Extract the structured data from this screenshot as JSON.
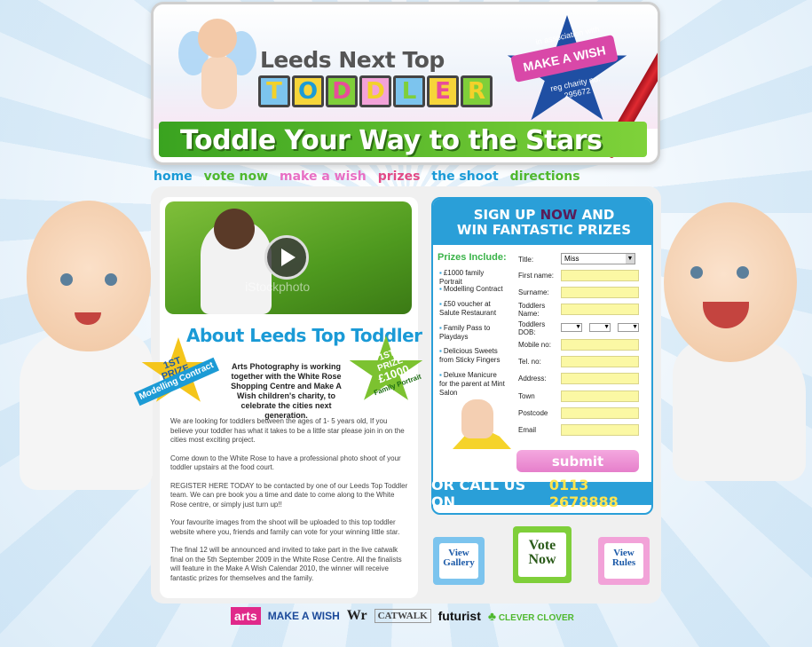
{
  "header": {
    "brand_top": "Leeds Next Top",
    "brand_letters": [
      "T",
      "O",
      "D",
      "D",
      "L",
      "E",
      "R"
    ],
    "badge_top": "in association with",
    "badge_ribbon": "MAKE A WISH",
    "badge_bottom_1": "reg charity no.",
    "badge_bottom_2": "295672",
    "tagline": "Toddle Your Way to the Stars"
  },
  "nav": {
    "items": [
      {
        "label": "home",
        "color": "#1a9ad6"
      },
      {
        "label": "vote now",
        "color": "#4fb82e"
      },
      {
        "label": "make a wish",
        "color": "#e86fc4"
      },
      {
        "label": "prizes",
        "color": "#e24a86"
      },
      {
        "label": "the shoot",
        "color": "#1a9ad6"
      },
      {
        "label": "directions",
        "color": "#4fb82e"
      }
    ]
  },
  "video": {
    "watermark": "iStockphoto"
  },
  "about": {
    "title": "About Leeds Top Toddler",
    "star1_line1": "1ST",
    "star1_line2": "PRIZE",
    "star1_ribbon": "Modelling Contract",
    "star2_line1": "1ST",
    "star2_line2": "PRIZE",
    "star2_line3": "£1000",
    "star2_line4": "Family Portrait",
    "intro": "Arts Photography is working together with the White Rose Shopping Centre and Make A Wish children's charity, to celebrate the cities next generation.",
    "paragraphs": [
      "We are looking for toddlers between the ages of 1- 5 years old, If you believe your toddler has what it takes to be a little star please join in on the cities most exciting project.",
      "Come down to the White Rose to have a professional photo shoot of your toddler upstairs at the food court.",
      "REGISTER HERE TODAY to be contacted by one of our Leeds Top Toddler team. We can pre book you a time and date to come along to the White Rose centre, or simply just turn up!!",
      "Your favourite images from the shoot will be uploaded to this top toddler website where you, friends and family can vote for your winning little star.",
      "The final 12 will be announced and invited to take part in the live catwalk final on the 5th September 2009 in the White Rose Centre. All the finalists will feature in the Make A Wish Calendar 2010, the winner will receive fantastic prizes for themselves and the family."
    ]
  },
  "signup": {
    "title_pre": "SIGN UP ",
    "title_now": "NOW",
    "title_post": " AND",
    "title_line2": "WIN FANTASTIC PRIZES",
    "prizes_head": "Prizes Include:",
    "prizes": [
      "£1000 family Portrait",
      "Modelling Contract",
      "£50 voucher at Salute Restaurant",
      "Family Pass to Playdays",
      "Delicious Sweets from Sticky Fingers",
      "Deluxe Manicure for the parent at Mint Salon"
    ],
    "labels": {
      "title": "Title:",
      "first_name": "First name:",
      "surname": "Surname:",
      "toddlers_name": "Toddlers Name:",
      "toddlers_dob": "Toddlers DOB:",
      "mobile": "Mobile no:",
      "tel": "Tel. no:",
      "address": "Address:",
      "town": "Town",
      "postcode": "Postcode",
      "email": "Email"
    },
    "title_value": "Miss",
    "submit": "submit",
    "call_label": "OR CALL US ON",
    "call_number": "0113 2678888"
  },
  "cubes": {
    "gallery": "View Gallery",
    "vote": "Vote Now",
    "rules": "View Rules"
  },
  "sponsors": [
    "arts",
    "MAKE A WISH",
    "Wr",
    "CATWALK",
    "futurist",
    "CLEVER CLOVER"
  ]
}
